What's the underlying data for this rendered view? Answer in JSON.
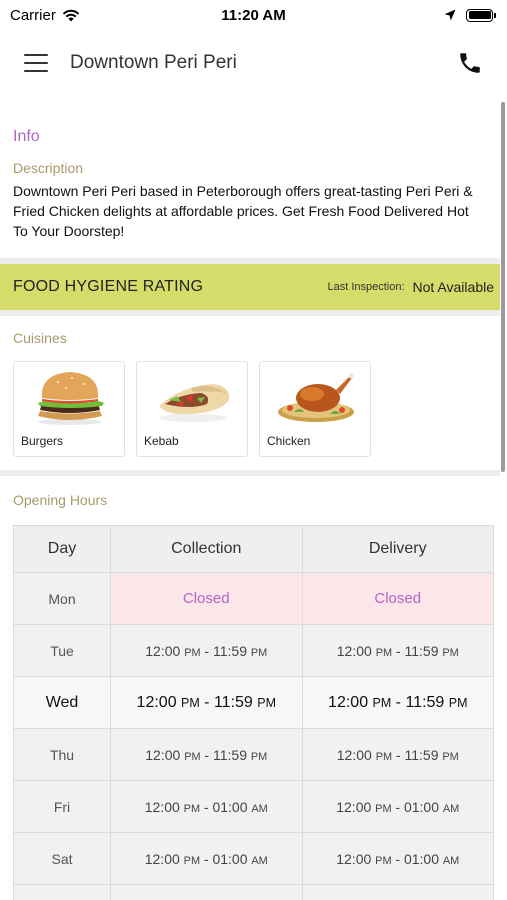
{
  "status_bar": {
    "carrier": "Carrier",
    "time": "11:20 AM"
  },
  "nav": {
    "title": "Downtown Peri Peri"
  },
  "info": {
    "heading": "Info",
    "description_label": "Description",
    "description": "Downtown Peri Peri based in Peterborough offers great-tasting Peri Peri & Fried Chicken delights at affordable prices. Get Fresh Food Delivered Hot To Your Doorstep!"
  },
  "hygiene": {
    "title": "FOOD HYGIENE RATING",
    "inspection_label": "Last Inspection:",
    "inspection_value": "Not Available"
  },
  "cuisines": {
    "heading": "Cuisines",
    "items": [
      {
        "label": "Burgers"
      },
      {
        "label": "Kebab"
      },
      {
        "label": "Chicken"
      }
    ]
  },
  "hours": {
    "heading": "Opening Hours",
    "columns": [
      "Day",
      "Collection",
      "Delivery"
    ],
    "rows": [
      {
        "day": "Mon",
        "collection": "Closed",
        "delivery": "Closed"
      },
      {
        "day": "Tue",
        "collection": "12:00 PM - 11:59 PM",
        "delivery": "12:00 PM - 11:59 PM"
      },
      {
        "day": "Wed",
        "collection": "12:00 PM - 11:59 PM",
        "delivery": "12:00 PM - 11:59 PM"
      },
      {
        "day": "Thu",
        "collection": "12:00 PM - 11:59 PM",
        "delivery": "12:00 PM - 11:59 PM"
      },
      {
        "day": "Fri",
        "collection": "12:00 PM - 01:00 AM",
        "delivery": "12:00 PM - 01:00 AM"
      },
      {
        "day": "Sat",
        "collection": "12:00 PM - 01:00 AM",
        "delivery": "12:00 PM - 01:00 AM"
      }
    ]
  },
  "colors": {
    "accent": "#b266c4",
    "hygiene_bg": "#d6dc6a",
    "sub_heading": "#a89a6a",
    "closed_bg": "#fbe6ea"
  }
}
